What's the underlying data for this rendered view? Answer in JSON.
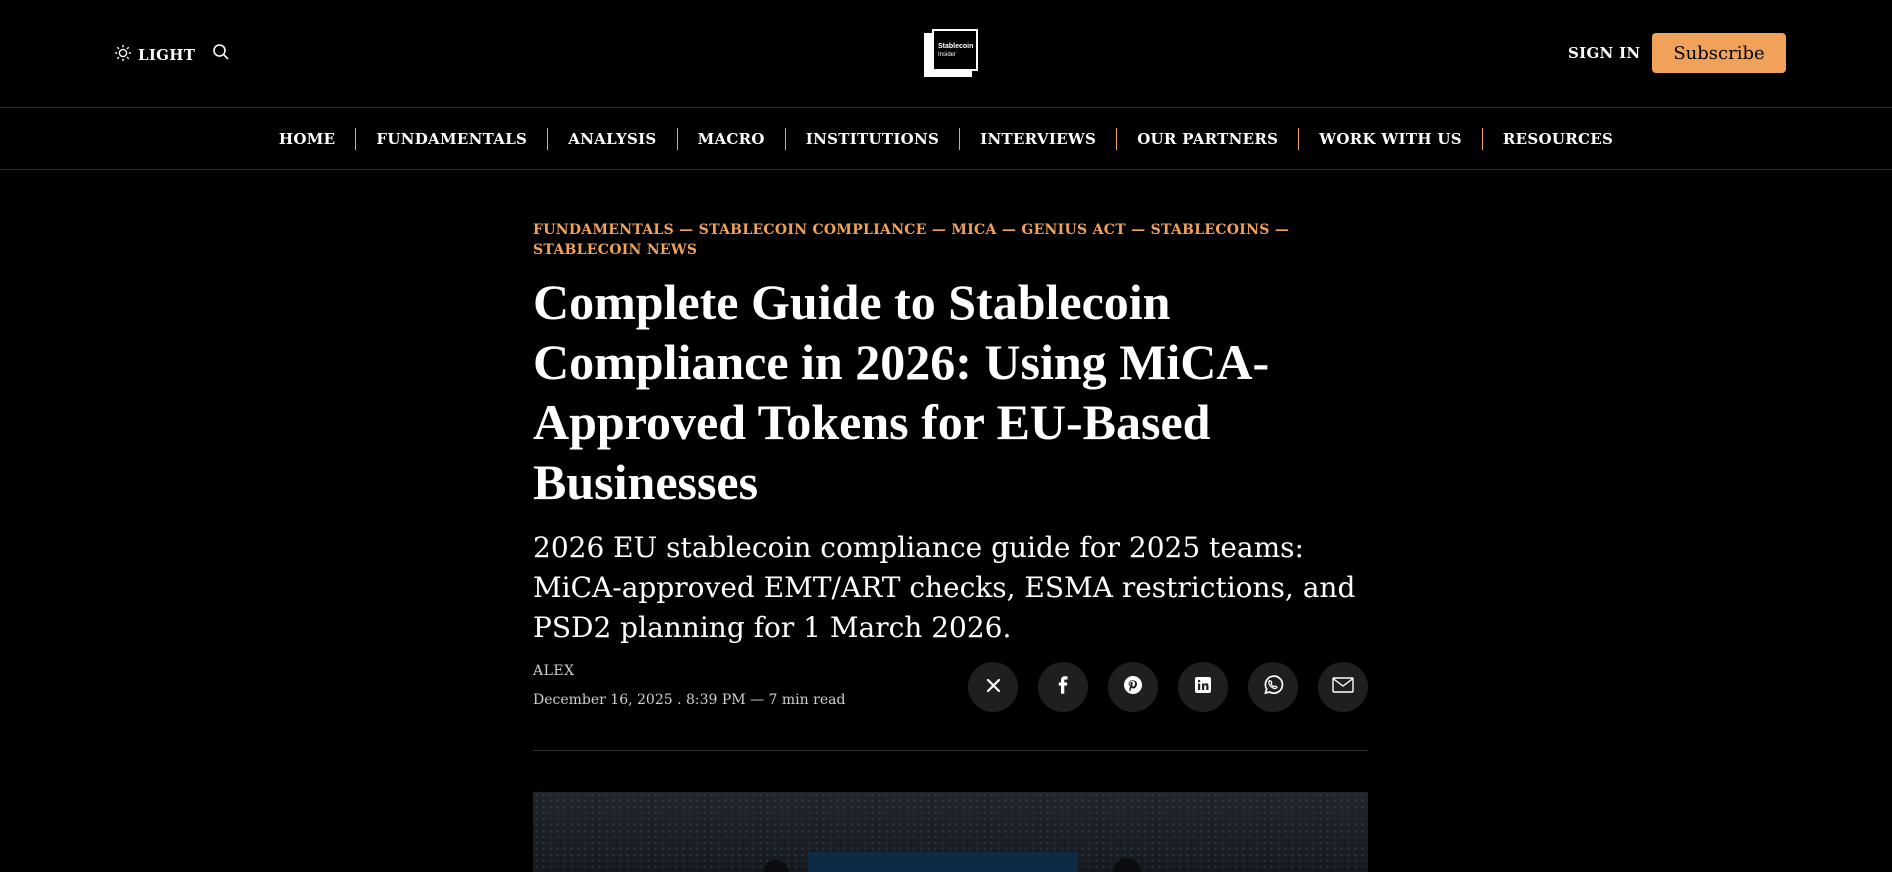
{
  "header": {
    "theme_label": "LIGHT",
    "logo_line1": "Stablecoin",
    "logo_line2": "Insider",
    "signin_label": "SIGN IN",
    "subscribe_label": "Subscribe",
    "accent_color": "#f0a25a"
  },
  "nav": {
    "items": [
      "HOME",
      "FUNDAMENTALS",
      "ANALYSIS",
      "MACRO",
      "INSTITUTIONS",
      "INTERVIEWS",
      "OUR PARTNERS",
      "WORK WITH US",
      "RESOURCES"
    ]
  },
  "article": {
    "categories": [
      "FUNDAMENTALS",
      "STABLECOIN COMPLIANCE",
      "MICA",
      "GENIUS ACT",
      "STABLECOINS",
      "STABLECOIN NEWS"
    ],
    "title": "Complete Guide to Stablecoin Compliance in 2026: Using MiCA-Approved Tokens for EU-Based Businesses",
    "subtitle": "2026 EU stablecoin compliance guide for 2025 teams: MiCA-approved EMT/ART checks, ESMA restrictions, and PSD2 planning for 1 March 2026.",
    "author": "ALEX",
    "date": "December 16, 2025 . 8:39 PM",
    "read_time": "7 min read",
    "share_icons": [
      "x-icon",
      "facebook-icon",
      "pinterest-icon",
      "linkedin-icon",
      "whatsapp-icon",
      "email-icon"
    ]
  }
}
